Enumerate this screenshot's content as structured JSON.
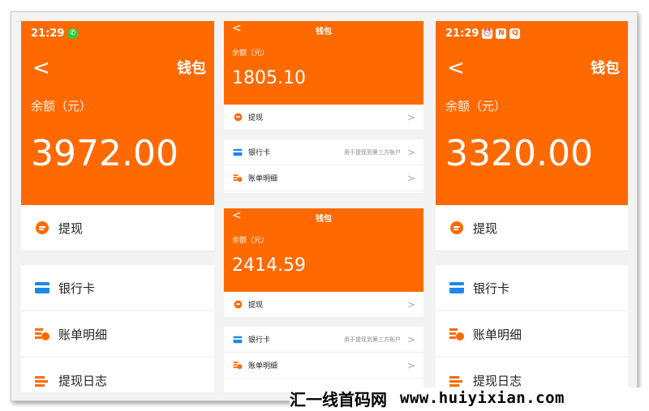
{
  "shared": {
    "page_title": "钱包",
    "balance_label": "余额（元）",
    "back_glyph": "<",
    "chevron_glyph": ">",
    "withdraw": "提现",
    "bank_card": "银行卡",
    "bill_detail": "账单明细",
    "withdraw_log": "提现日志",
    "bank_hint": "用于提现到第三方账户"
  },
  "left": {
    "time": "21:29",
    "amount": "3972.00"
  },
  "middle_top": {
    "amount": "1805.10"
  },
  "middle_bottom": {
    "amount": "2414.59"
  },
  "right": {
    "time": "21:29",
    "amount": "3320.00"
  },
  "watermark": {
    "brand": "汇一线首码网",
    "url": "www.huiyixian.com"
  },
  "colors": {
    "accent": "#ff6a00",
    "card_icon": "#1e88e5"
  },
  "icons": [
    "wechat-icon",
    "alarm-icon",
    "nfc-icon",
    "qq-icon",
    "back-arrow-icon",
    "withdraw-icon",
    "bank-card-icon",
    "bill-icon",
    "withdraw-log-icon",
    "chevron-right-icon"
  ]
}
